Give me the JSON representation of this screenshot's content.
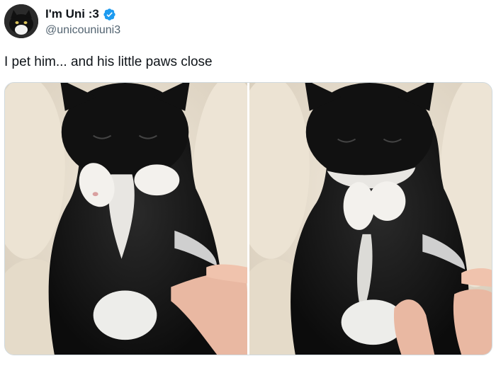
{
  "tweet": {
    "display_name": "I'm Uni :3",
    "handle": "@unicouniuni3",
    "text": "I pet him... and his little paws close",
    "verified": true
  },
  "icons": {
    "verified": "verified-badge-icon",
    "avatar": "cat-avatar"
  },
  "colors": {
    "verified_blue": "#1d9bf0",
    "text_primary": "#0f1419",
    "text_secondary": "#536471",
    "border": "#cfd9de"
  },
  "media": {
    "photos": [
      {
        "id": "photo-left"
      },
      {
        "id": "photo-right"
      }
    ]
  }
}
